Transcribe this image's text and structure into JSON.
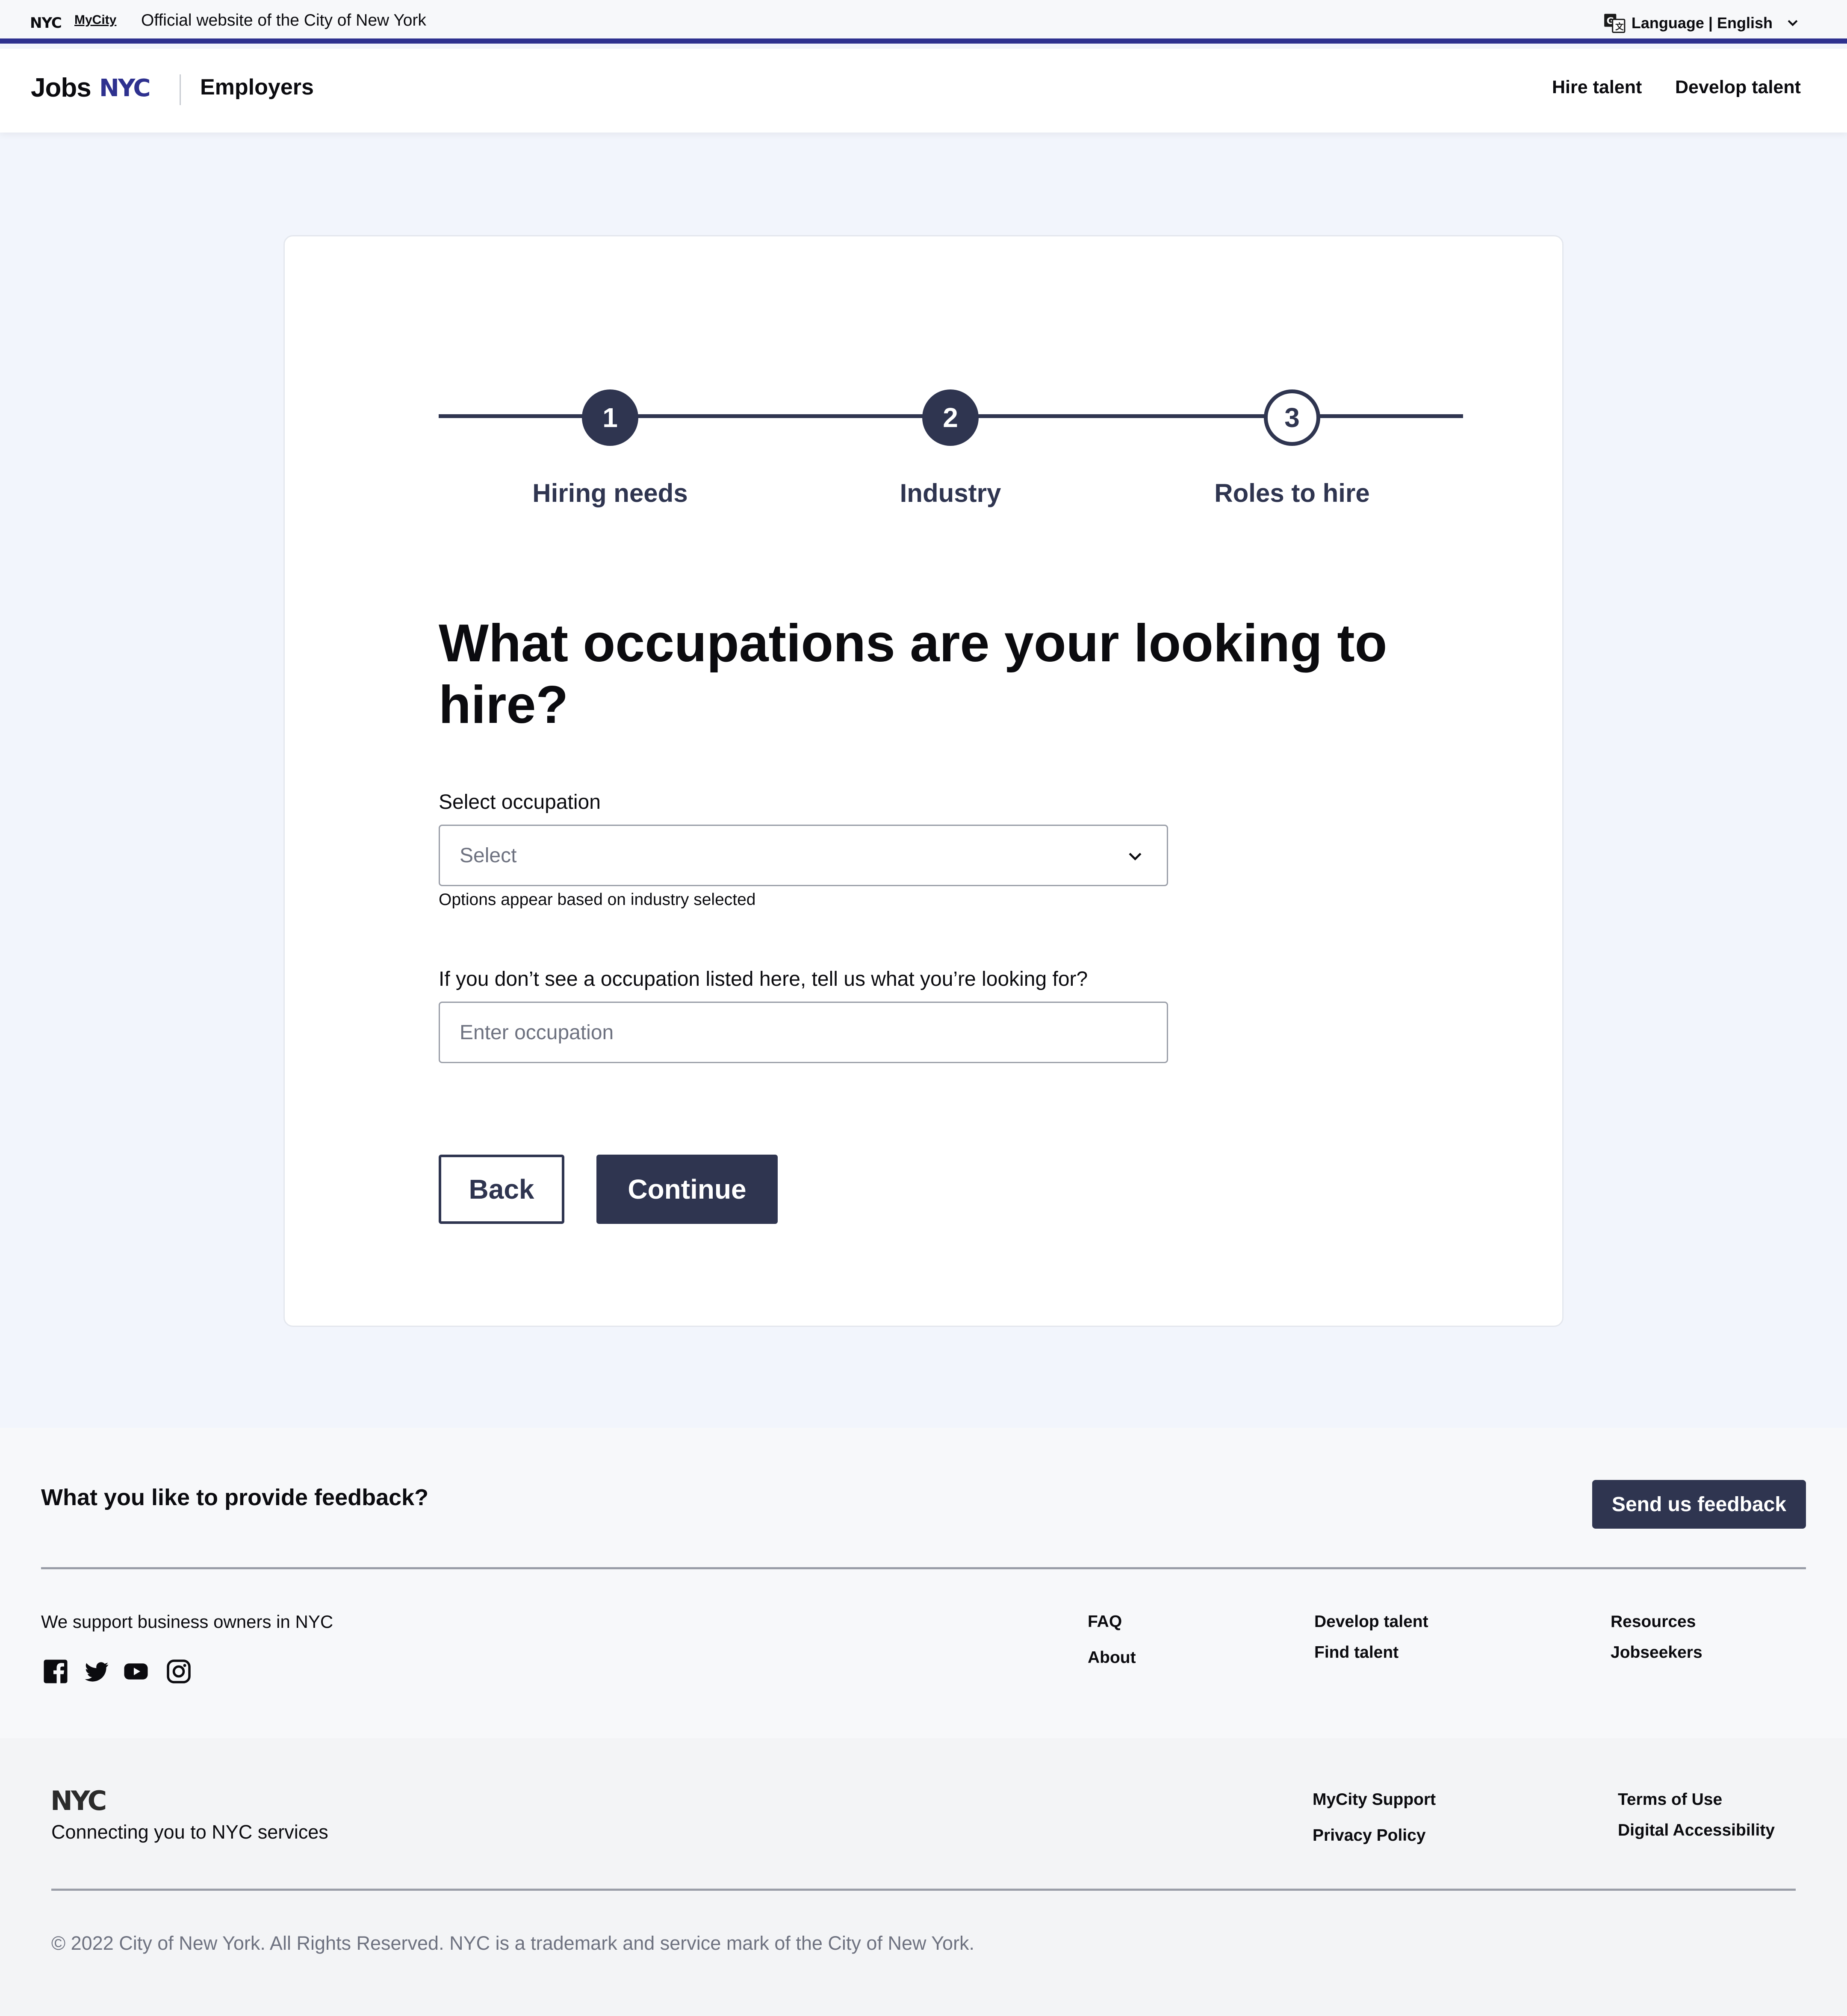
{
  "topbar": {
    "nyc_mark": "NYC",
    "mycity": "MyCity",
    "official_text": "Official website of the City of New York",
    "language_label": "Language | English"
  },
  "header": {
    "logo_jobs": "Jobs",
    "logo_nyc": "NYC",
    "section": "Employers",
    "nav": [
      {
        "label": "Hire talent"
      },
      {
        "label": "Develop talent"
      }
    ]
  },
  "stepper": {
    "steps": [
      {
        "number": "1",
        "label": "Hiring needs",
        "state": "complete"
      },
      {
        "number": "2",
        "label": "Industry",
        "state": "complete"
      },
      {
        "number": "3",
        "label": "Roles to hire",
        "state": "current"
      }
    ]
  },
  "form": {
    "heading": "What occupations are your looking to hire?",
    "select_label": "Select occupation",
    "select_placeholder": "Select",
    "select_helper": "Options appear based on industry selected",
    "other_label": "If you don’t see a occupation listed here, tell us what you’re looking for?",
    "other_placeholder": "Enter occupation",
    "back_label": "Back",
    "continue_label": "Continue"
  },
  "footer": {
    "feedback_question": "What you like to provide feedback?",
    "feedback_button": "Send us feedback",
    "support_text": "We support business owners in NYC",
    "social_icons": [
      "facebook-icon",
      "twitter-icon",
      "youtube-icon",
      "instagram-icon"
    ],
    "links_col1": [
      "FAQ",
      "About"
    ],
    "links_col2": [
      "Develop talent",
      "Find talent"
    ],
    "links_col3": [
      "Resources",
      "Jobseekers"
    ]
  },
  "bottom_footer": {
    "nyc_mark": "NYC",
    "connecting": "Connecting you to NYC services",
    "links_col1": [
      "MyCity Support",
      "Privacy Policy"
    ],
    "links_col2": [
      "Terms of Use",
      "Digital Accessibility"
    ],
    "copyright": "© 2022 City of New York. All Rights Reserved. NYC is a trademark and service mark of the City of New York."
  },
  "colors": {
    "brand_navy": "#2f3550",
    "nyc_blue": "#2e318f",
    "page_bg": "#f2f5fc"
  }
}
